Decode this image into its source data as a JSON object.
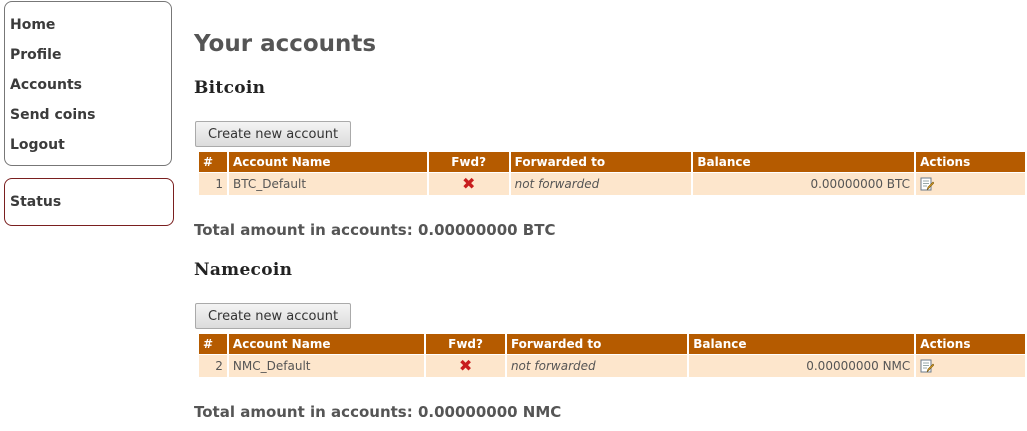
{
  "nav": {
    "items": [
      {
        "label": "Home"
      },
      {
        "label": "Profile"
      },
      {
        "label": "Accounts"
      },
      {
        "label": "Send coins"
      },
      {
        "label": "Logout"
      }
    ],
    "status_label": "Status"
  },
  "page_title": "Your accounts",
  "table_headers": {
    "num": "#",
    "name": "Account Name",
    "fwd": "Fwd?",
    "forwarded_to": "Forwarded to",
    "balance": "Balance",
    "actions": "Actions"
  },
  "sections": [
    {
      "title": "Bitcoin",
      "create_label": "Create new account",
      "rows": [
        {
          "num": "1",
          "name": "BTC_Default",
          "fwd_icon": "cross-icon",
          "forwarded_to": "not forwarded",
          "balance": "0.00000000 BTC",
          "action_icon": "edit-icon"
        }
      ],
      "total": "Total amount in accounts: 0.00000000 BTC"
    },
    {
      "title": "Namecoin",
      "create_label": "Create new account",
      "rows": [
        {
          "num": "2",
          "name": "NMC_Default",
          "fwd_icon": "cross-icon",
          "forwarded_to": "not forwarded",
          "balance": "0.00000000 NMC",
          "action_icon": "edit-icon"
        }
      ],
      "total": "Total amount in accounts: 0.00000000 NMC"
    }
  ],
  "colors": {
    "header_bg": "#b55b00",
    "row_bg": "#fde6cc",
    "cross": "#c81e1e",
    "status_border": "#7a1f1f"
  }
}
